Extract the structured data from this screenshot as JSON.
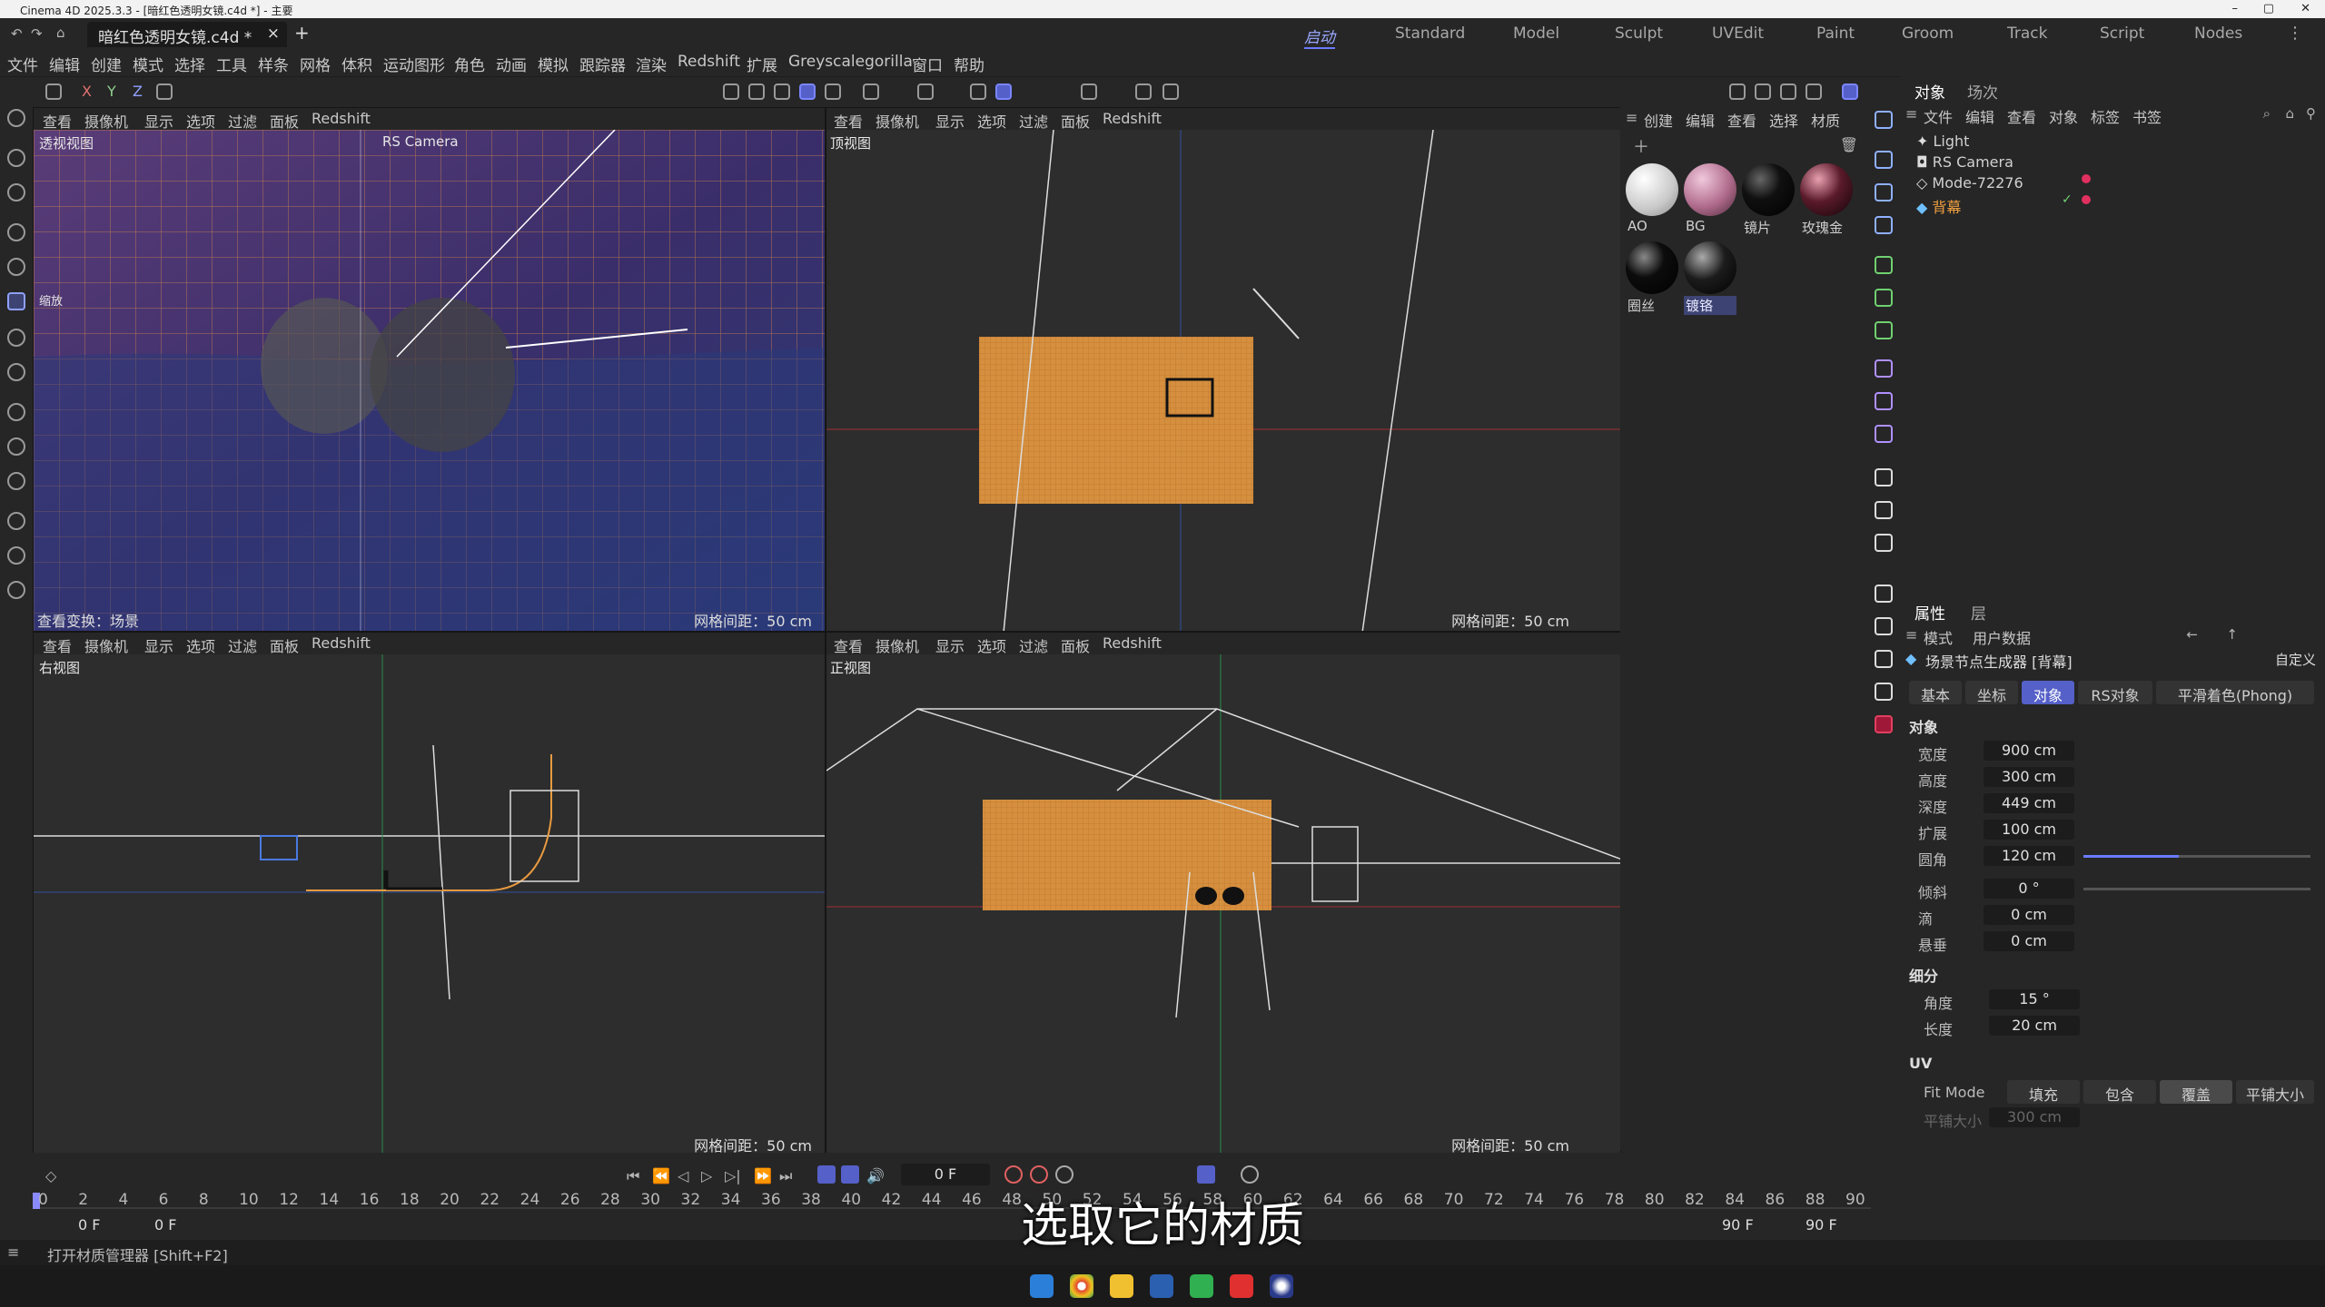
{
  "window": {
    "title": "Cinema 4D 2025.3.3 - [暗红色透明女镜.c4d *] - 主要"
  },
  "tabs": {
    "document": "暗红色透明女镜.c4d *",
    "close": "×",
    "add": "+"
  },
  "layouts": [
    "启动",
    "Standard",
    "Model",
    "Sculpt",
    "UVEdit",
    "Paint",
    "Groom",
    "Track",
    "Script",
    "Nodes"
  ],
  "menu": [
    "文件",
    "编辑",
    "创建",
    "模式",
    "选择",
    "工具",
    "样条",
    "网格",
    "体积",
    "运动图形",
    "角色",
    "动画",
    "模拟",
    "跟踪器",
    "渲染",
    "Redshift",
    "扩展",
    "Greyscalegorilla",
    "窗口",
    "帮助"
  ],
  "toolbar": {
    "axis_x": "X",
    "axis_y": "Y",
    "axis_z": "Z"
  },
  "viewport_menu": [
    "查看",
    "摄像机",
    "显示",
    "选项",
    "过滤",
    "面板",
    "Redshift"
  ],
  "viewports": {
    "perspective": {
      "label": "透视视图",
      "camera": "RS Camera",
      "status": "查看变换：场景",
      "grid": "网格间距：50 cm",
      "zoom_label": "缩放"
    },
    "top": {
      "label": "顶视图",
      "grid": "网格间距：50 cm"
    },
    "right": {
      "label": "右视图",
      "grid": "网格间距：50 cm"
    },
    "front": {
      "label": "正视图",
      "grid": "网格间距：50 cm"
    }
  },
  "material_menu": [
    "创建",
    "编辑",
    "查看",
    "选择",
    "材质"
  ],
  "materials": [
    {
      "name": "AO",
      "color": "#d8d8d8"
    },
    {
      "name": "BG",
      "color": "#b06b8c"
    },
    {
      "name": "镜片",
      "color": "#101010"
    },
    {
      "name": "玫瑰金",
      "color": "#5a1a2a"
    },
    {
      "name": "圈丝",
      "color": "#0c0c0c"
    },
    {
      "name": "镀铬",
      "color": "#1c1c1c",
      "selected": true
    }
  ],
  "object_panel": {
    "tabs": [
      "对象",
      "场次"
    ],
    "menu": [
      "文件",
      "编辑",
      "查看",
      "对象",
      "标签",
      "书签"
    ],
    "objects": [
      {
        "name": "Light"
      },
      {
        "name": "RS Camera"
      },
      {
        "name": "Mode-72276"
      },
      {
        "name": "背幕",
        "selected": true
      }
    ]
  },
  "attributes": {
    "tabs": [
      "属性",
      "层"
    ],
    "menu": [
      "模式",
      "用户数据"
    ],
    "title": "场景节点生成器 [背幕]",
    "preset": "自定义",
    "subtabs": [
      "基本",
      "坐标",
      "对象",
      "RS对象",
      "平滑着色(Phong)"
    ],
    "section": "对象",
    "props": [
      {
        "label": "宽度",
        "value": "900 cm"
      },
      {
        "label": "高度",
        "value": "300 cm"
      },
      {
        "label": "深度",
        "value": "449 cm"
      },
      {
        "label": "扩展",
        "value": "100 cm"
      },
      {
        "label": "圆角",
        "value": "120 cm"
      },
      {
        "label": "倾斜",
        "value": "0 °"
      },
      {
        "label": "滴",
        "value": "0 cm"
      },
      {
        "label": "悬垂",
        "value": "0 cm"
      }
    ],
    "subdiv_section": "细分",
    "subdiv": [
      {
        "label": "角度",
        "value": "15 °"
      },
      {
        "label": "长度",
        "value": "20 cm"
      }
    ],
    "uv_section": "UV",
    "fit_mode_label": "Fit Mode",
    "fit_modes": [
      "填充",
      "包含",
      "覆盖",
      "平铺大小"
    ],
    "tile_size_label": "平铺大小",
    "tile_size_value": "300 cm"
  },
  "timeline": {
    "current_frame": "0 F",
    "start": "0 F",
    "start2": "0 F",
    "end": "90 F",
    "end2": "90 F",
    "ticks": [
      "0",
      "2",
      "4",
      "6",
      "8",
      "10",
      "12",
      "14",
      "16",
      "18",
      "20",
      "22",
      "24",
      "26",
      "28",
      "30",
      "32",
      "34",
      "36",
      "38",
      "40",
      "42",
      "44",
      "46",
      "48",
      "50",
      "52",
      "54",
      "56",
      "58",
      "60",
      "62",
      "64",
      "66",
      "68",
      "70",
      "72",
      "74",
      "76",
      "78",
      "80",
      "82",
      "84",
      "86",
      "88",
      "90"
    ]
  },
  "status": {
    "text": "打开材质管理器 [Shift+F2]"
  },
  "subtitle": "选取它的材质"
}
